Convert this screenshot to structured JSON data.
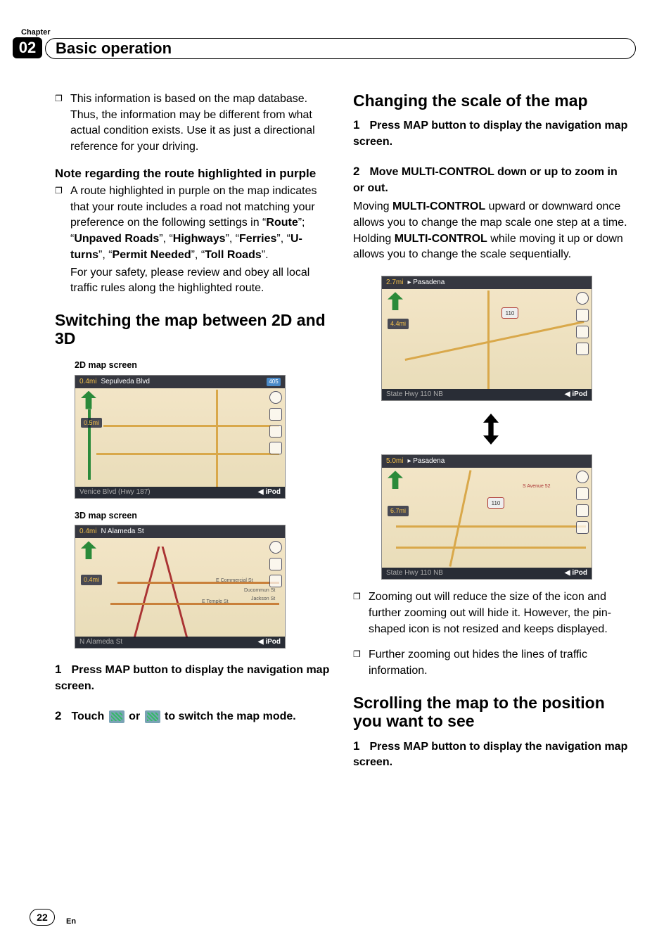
{
  "chapter": {
    "label": "Chapter",
    "number": "02"
  },
  "header": {
    "title": "Basic operation"
  },
  "left": {
    "bullet1": "This information is based on the map database. Thus, the information may be different from what actual condition exists. Use it as just a directional reference for your driving.",
    "subhead1": "Note regarding the route highlighted in purple",
    "bullet2a": "A route highlighted in purple on the map indicates that your route includes a road not matching your preference on the following settings in “",
    "route": "Route",
    "b2b": "”; “",
    "unpaved": "Unpaved Roads",
    "b2c": "”, “",
    "highways": "Highways",
    "b2d": "”, “",
    "ferries": "Ferries",
    "b2e": "”, “",
    "uturns": "U-turns",
    "b2f": "”, “",
    "permit": "Permit Needed",
    "b2g": "”, “",
    "toll": "Toll Roads",
    "b2h": "”.",
    "bullet2tail": "For your safety, please review and obey all local traffic rules along the highlighted route.",
    "section2d3d": "Switching the map between 2D and 3D",
    "label2d": "2D map screen",
    "label3d": "3D map screen",
    "map1": {
      "top": "Sepulveda Blvd",
      "dist1": "0.4mi",
      "dist2": "0.5mi",
      "bot": "Venice Blvd (Hwy 187)",
      "ipod": "iPod",
      "badge": "405"
    },
    "map2": {
      "top": "N Alameda St",
      "dist1": "0.4mi",
      "dist2": "0.4mi",
      "bot": "N Alameda St",
      "ipod": "iPod",
      "r1": "E Commercial St",
      "r2": "E Temple St",
      "r3": "Ducommun St",
      "r4": "Jackson St"
    },
    "step1num": "1",
    "step1": "Press MAP button to display the navigation map screen.",
    "step2num": "2",
    "step2a": "Touch ",
    "step2b": " or ",
    "step2c": " to switch the map mode."
  },
  "right": {
    "sectionScale": "Changing the scale of the map",
    "step1num": "1",
    "step1": "Press MAP button to display the navigation map screen.",
    "step2num": "2",
    "step2": "Move MULTI-CONTROL down or up to zoom in or out.",
    "para1a": "Moving ",
    "mc": "MULTI-CONTROL",
    "para1b": " upward or downward once allows you to change the map scale one step at a time. Holding ",
    "mc2": "MULTI-CONTROL",
    "para1c": " while moving it up or down allows you to change the scale sequentially.",
    "map3": {
      "top": "Pasadena",
      "dist1": "2.7mi",
      "dist2": "4.4mi",
      "bot": "State Hwy 110 NB",
      "ipod": "iPod",
      "shield": "110"
    },
    "map4": {
      "top": "Pasadena",
      "dist1": "5.0mi",
      "dist2": "6.7mi",
      "bot": "State Hwy 110 NB",
      "ipod": "iPod",
      "shield": "110",
      "avenue": "S Avenue 52"
    },
    "bullet3": "Zooming out will reduce the size of the icon and further zooming out will hide it. However, the pin-shaped icon is not resized and keeps displayed.",
    "bullet4": "Further zooming out hides the lines of traffic information.",
    "sectionScroll": "Scrolling the map to the position you want to see",
    "stepS1num": "1",
    "stepS1": "Press MAP button to display the navigation map screen."
  },
  "footer": {
    "page": "22",
    "lang": "En"
  }
}
